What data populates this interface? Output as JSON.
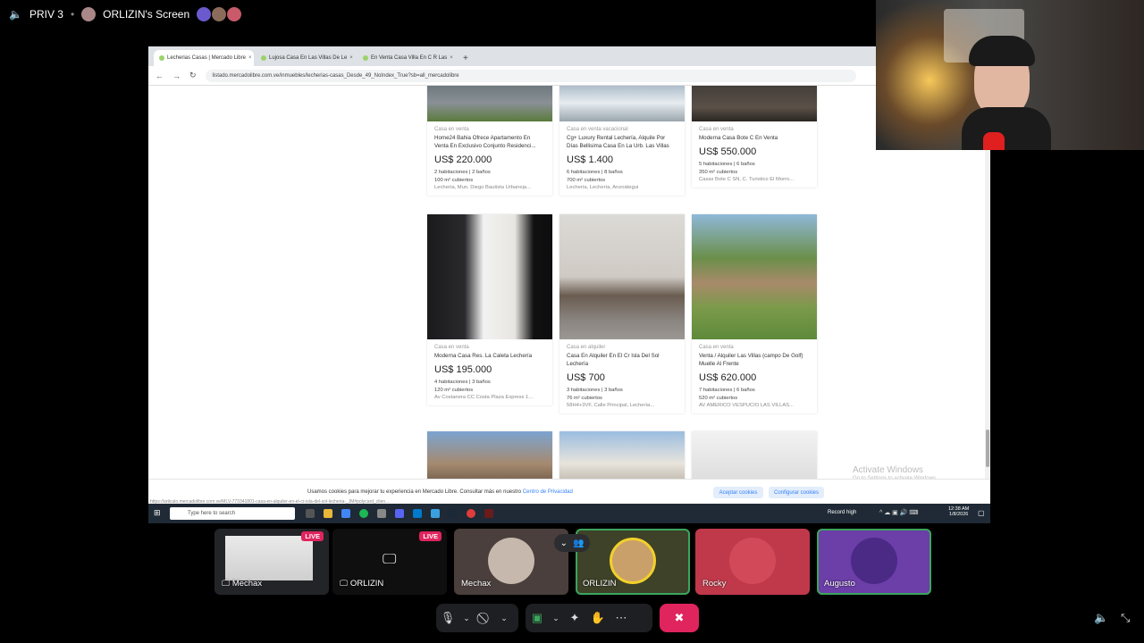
{
  "topbar": {
    "channel": "PRIV 3",
    "screen_label": "ORLIZIN's Screen"
  },
  "browser": {
    "tabs": [
      {
        "label": "Lecherias Casas | Mercado Libre"
      },
      {
        "label": "Lujosa Casa En Las Villas De Le"
      },
      {
        "label": "En Venta Casa Villa En C R Las"
      }
    ],
    "url": "listado.mercadolibre.com.ve/inmuebles/lecherias-casas_Desde_49_NoIndex_True?sb=all_mercadolibre"
  },
  "listings": [
    {
      "category": "Casa en venta",
      "title": "Home24 Bahia Ofrece Apartamento En Venta En Exclusivo Conjunto Residenci...",
      "price": "US$ 220.000",
      "attr1": "2 habitaciones | 2 baños",
      "attr2": "100 m² cubiertos",
      "location": "Lechería, Mun. Diego Bautista Urbaneja..."
    },
    {
      "category": "Casa en venta vacacional",
      "title": "Cg+ Luxury Rental Lechería, Alquile Por Días Bellisima Casa En La Urb. Las Villas",
      "price": "US$ 1.400",
      "attr1": "6 habitaciones | 8 baños",
      "attr2": "700 m² cubiertos",
      "location": "Lechería, Lechería, Anzoátegui"
    },
    {
      "category": "Casa en venta",
      "title": "Moderna Casa Bote C En Venta",
      "price": "US$ 550.000",
      "attr1": "5 habitaciones | 6 baños",
      "attr2": "350 m² cubiertos",
      "location": "Casas Bote C SN, C. Turistico El Morro..."
    },
    {
      "category": "Casa en venta",
      "title": "Moderna Casa Res. La Caleta Lechería",
      "price": "US$ 195.000",
      "attr1": "4 habitaciones | 3 baños",
      "attr2": "120 m² cubiertos",
      "location": "Av Costanera CC Costa Plaza Express 1..."
    },
    {
      "category": "Casa en alquiler",
      "title": "Casa En Alquiler En El Cr Isla Del Sol Lechería",
      "price": "US$ 700",
      "attr1": "3 habitaciones | 3 baños",
      "attr2": "76 m² cubiertos",
      "location": "58H4+3VF, Calle Principal, Lechería..."
    },
    {
      "category": "Casa en venta",
      "title": "Venta / Alquiler Las Villas (campo De Golf) Muelle Al Frente",
      "price": "US$ 620.000",
      "attr1": "7 habitaciones | 6 baños",
      "attr2": "520 m² cubiertos",
      "location": "AV AMERICO VESPUCIO LAS VILLAS..."
    }
  ],
  "cookie": {
    "text": "Usamos cookies para mejorar tu experiencia en Mercado Libre. Consultar más en nuestro",
    "link": "Centro de Privacidad",
    "accept": "Aceptar cookies",
    "configure": "Configurar cookies"
  },
  "windows": {
    "activate_title": "Activate Windows",
    "activate_sub": "Go to Settings to activate Windows.",
    "search": "Type here to search",
    "record": "Record high",
    "time": "12:38 AM",
    "date": "1/8/2026",
    "tooltip": "https://articulo.mercadolibre.com.ve/MLV-773341801-casa-en-alquiler-en-el-cr-isla-del-sol-lecheria-_JM#polycard_clien..."
  },
  "participants": [
    {
      "name": "Mechax",
      "live": "LIVE"
    },
    {
      "name": "ORLIZIN",
      "live": "LIVE"
    },
    {
      "name": "Mechax"
    },
    {
      "name": "ORLIZIN"
    },
    {
      "name": "Rocky"
    },
    {
      "name": "Augusto"
    }
  ],
  "colors": {
    "hangup": "#e0245e",
    "accent_green": "#3ba55d",
    "live": "#e0245e"
  }
}
